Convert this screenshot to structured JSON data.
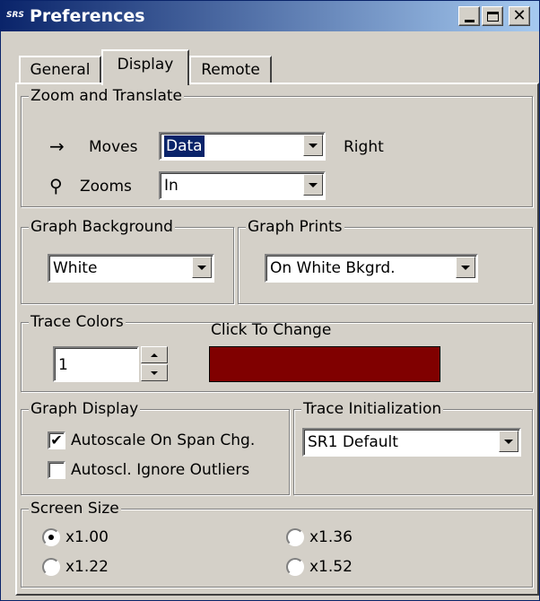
{
  "window": {
    "app_icon_text": "SRS",
    "title": "Preferences",
    "minimize_glyph": "_",
    "maximize_glyph": "□",
    "close_glyph": "✕"
  },
  "tabs": [
    {
      "label": "General"
    },
    {
      "label": "Display"
    },
    {
      "label": "Remote"
    }
  ],
  "zoom_translate": {
    "legend": "Zoom and Translate",
    "moves_icon_glyph": "→",
    "moves_label": "Moves",
    "moves_value": "Data",
    "moves_suffix": "Right",
    "zooms_icon_glyph": "⚲",
    "zooms_label": "Zooms",
    "zooms_value": "In"
  },
  "graph_background": {
    "legend": "Graph Background",
    "value": "White"
  },
  "graph_prints": {
    "legend": "Graph Prints",
    "value": "On White Bkgrd."
  },
  "trace_colors": {
    "legend": "Trace Colors",
    "click_label": "Click To Change",
    "trace_number": "1",
    "color": "#800000"
  },
  "graph_display": {
    "legend": "Graph Display",
    "autoscale_label": "Autoscale On Span Chg.",
    "autoscale_checked": true,
    "ignore_outliers_label": "Autoscl. Ignore Outliers",
    "ignore_outliers_checked": false
  },
  "trace_init": {
    "legend": "Trace Initialization",
    "value": "SR1 Default"
  },
  "screen_size": {
    "legend": "Screen Size",
    "options": [
      {
        "label": "x1.00",
        "selected": true
      },
      {
        "label": "x1.22",
        "selected": false
      },
      {
        "label": "x1.36",
        "selected": false
      },
      {
        "label": "x1.52",
        "selected": false
      }
    ]
  },
  "colors": {
    "titlebar_start": "#0a246a",
    "titlebar_end": "#a6caf0",
    "face": "#d4d0c8",
    "selection": "#0a246a"
  }
}
